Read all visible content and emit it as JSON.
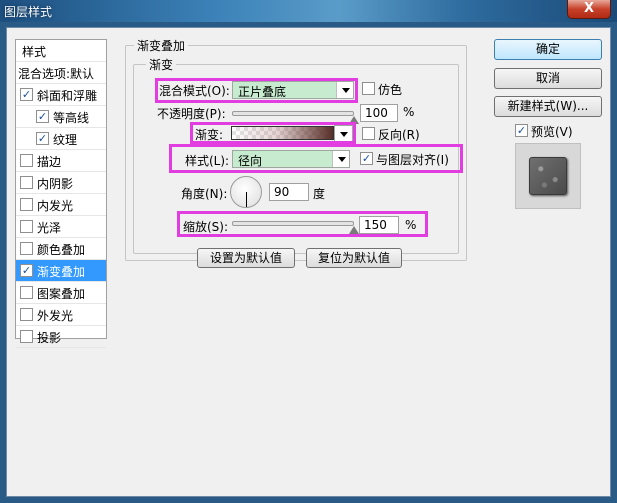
{
  "window": {
    "title": "图层样式",
    "close_label": "X"
  },
  "sidebar": {
    "header": "样式",
    "blend_options": "混合选项:默认",
    "items": [
      {
        "label": "斜面和浮雕",
        "checked": true
      },
      {
        "label": "等高线",
        "checked": true
      },
      {
        "label": "纹理",
        "checked": true
      },
      {
        "label": "描边",
        "checked": false
      },
      {
        "label": "内阴影",
        "checked": false
      },
      {
        "label": "内发光",
        "checked": false
      },
      {
        "label": "光泽",
        "checked": false
      },
      {
        "label": "颜色叠加",
        "checked": false
      },
      {
        "label": "渐变叠加",
        "checked": true,
        "selected": true
      },
      {
        "label": "图案叠加",
        "checked": false
      },
      {
        "label": "外发光",
        "checked": false
      },
      {
        "label": "投影",
        "checked": false
      }
    ]
  },
  "panel": {
    "group_title": "渐变叠加",
    "subgroup_title": "渐变",
    "blend_mode_label": "混合模式(O):",
    "blend_mode_value": "正片叠底",
    "dither_label": "仿色",
    "opacity_label": "不透明度(P):",
    "opacity_value": "100",
    "opacity_unit": "%",
    "opacity_level": 1.0,
    "gradient_label": "渐变:",
    "reverse_label": "反向(R)",
    "style_label": "样式(L):",
    "style_value": "径向",
    "align_label": "与图层对齐(I)",
    "angle_label": "角度(N):",
    "angle_value": "90",
    "angle_unit": "度",
    "scale_label": "缩放(S):",
    "scale_value": "150",
    "scale_unit": "%",
    "scale_level": 1.0,
    "set_default_button": "设置为默认值",
    "reset_default_button": "复位为默认值"
  },
  "actions": {
    "ok": "确定",
    "cancel": "取消",
    "new_style": "新建样式(W)...",
    "preview_label": "预览(V)",
    "preview_checked": true
  },
  "colors": {
    "highlight": "#e23de0",
    "selection": "#3399ff",
    "select_fill": "#c7ebcf"
  }
}
